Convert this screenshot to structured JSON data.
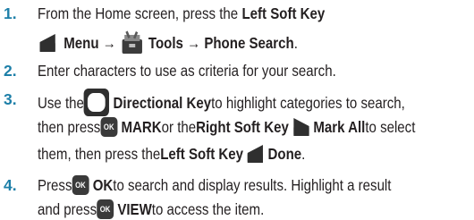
{
  "steps": [
    {
      "number": "1.",
      "line1": {
        "a": "From the Home screen, press the ",
        "b_bold": "Left Soft Key"
      },
      "line2": {
        "menu_arrow": "Menu →",
        "tools_arrow": "Tools → Phone Search",
        "period": "."
      }
    },
    {
      "number": "2.",
      "text": "Enter characters to use as criteria for your search."
    },
    {
      "number": "3.",
      "line1": {
        "a": "Use the ",
        "b_bold": "Directional Key",
        "c": " to highlight categories to search,"
      },
      "line2": {
        "a": "then press ",
        "mark_bold": "MARK",
        "b": " or the ",
        "rsk_bold": "Right Soft Key",
        "markall_bold": "Mark All",
        "c": " to select"
      },
      "line3": {
        "a": "them, then press the ",
        "lsk_bold": "Left Soft Key",
        "done_bold": "Done",
        "period": "."
      }
    },
    {
      "number": "4.",
      "line1": {
        "a": "Press ",
        "ok_bold": "OK",
        "b": " to search and display results. Highlight a result"
      },
      "line2": {
        "a": "and press ",
        "view_bold": "VIEW",
        "b": " to access the item."
      }
    }
  ],
  "icons": {
    "ok_key_label": "OK",
    "soft_key_color": "#2f2f2f",
    "step_number_color": "#1d7fa8"
  }
}
